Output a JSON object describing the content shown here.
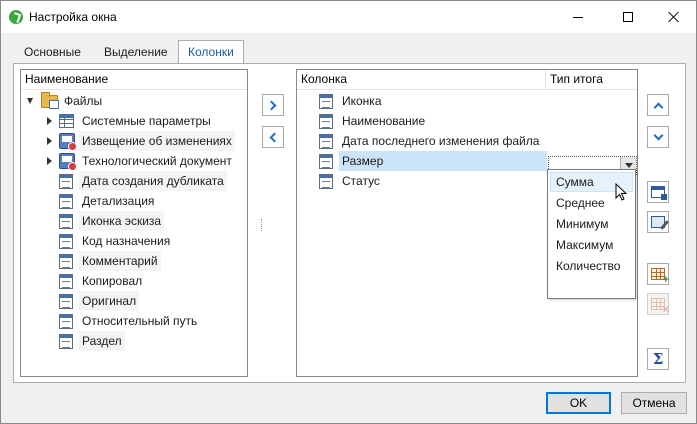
{
  "window": {
    "title": "Настройка окна"
  },
  "tabs": [
    {
      "label": "Основные",
      "active": false
    },
    {
      "label": "Выделение",
      "active": false
    },
    {
      "label": "Колонки",
      "active": true
    }
  ],
  "available": {
    "header": "Наименование",
    "root": {
      "label": "Файлы",
      "icon": "folder-icon",
      "expanded": true
    },
    "items": [
      {
        "label": "Системные параметры",
        "icon": "table-icon",
        "expandable": true
      },
      {
        "label": "Извещение об изменениях",
        "icon": "notice-icon",
        "expandable": true
      },
      {
        "label": "Технологический документ",
        "icon": "notice-icon",
        "expandable": true
      },
      {
        "label": "Дата создания дубликата",
        "icon": "document-icon",
        "expandable": false
      },
      {
        "label": "Детализация",
        "icon": "document-icon",
        "expandable": false
      },
      {
        "label": "Иконка эскиза",
        "icon": "document-icon",
        "expandable": false
      },
      {
        "label": "Код назначения",
        "icon": "document-icon",
        "expandable": false
      },
      {
        "label": "Комментарий",
        "icon": "document-icon",
        "expandable": false
      },
      {
        "label": "Копировал",
        "icon": "document-icon",
        "expandable": false
      },
      {
        "label": "Оригинал",
        "icon": "document-icon",
        "expandable": false
      },
      {
        "label": "Относительный путь",
        "icon": "document-icon",
        "expandable": false
      },
      {
        "label": "Раздел",
        "icon": "document-icon",
        "expandable": false
      }
    ]
  },
  "selected_columns": {
    "headers": {
      "column": "Колонка",
      "total_type": "Тип итога"
    },
    "rows": [
      {
        "label": "Иконка",
        "total": ""
      },
      {
        "label": "Наименование",
        "total": ""
      },
      {
        "label": "Дата последнего изменения файла",
        "total": ""
      },
      {
        "label": "Размер",
        "total": "",
        "selected": true
      },
      {
        "label": "Статус",
        "total": ""
      }
    ]
  },
  "total_dropdown": {
    "options": [
      "Сумма",
      "Среднее",
      "Минимум",
      "Максимум",
      "Количество"
    ],
    "hovered": "Сумма"
  },
  "side_buttons": [
    {
      "icon": "arrow-up-icon",
      "enabled": true
    },
    {
      "icon": "arrow-down-icon",
      "enabled": true
    },
    {
      "icon": "column-settings-icon",
      "enabled": true
    },
    {
      "icon": "edit-column-icon",
      "enabled": true
    },
    {
      "icon": "add-column-icon",
      "enabled": true
    },
    {
      "icon": "remove-column-icon",
      "enabled": false
    },
    {
      "icon": "sigma-icon",
      "enabled": true
    }
  ],
  "buttons": {
    "ok": "OK",
    "cancel": "Отмена"
  }
}
